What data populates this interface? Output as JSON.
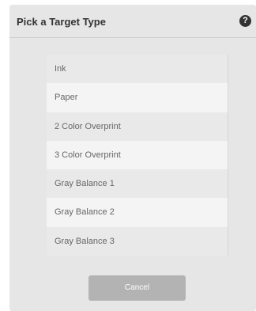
{
  "dialog": {
    "title": "Pick a Target Type",
    "help_icon": {
      "icon": "help-icon",
      "glyph": "?"
    }
  },
  "target_types": [
    "Ink",
    "Paper",
    "2 Color Overprint",
    "3 Color Overprint",
    "Gray Balance 1",
    "Gray Balance 2",
    "Gray Balance 3"
  ],
  "actions": {
    "cancel_label": "Cancel"
  },
  "colors": {
    "dialog_bg": "#e6e6e6",
    "title_text": "#333333",
    "item_text": "#666666",
    "button_bg": "#b3b3b3"
  }
}
